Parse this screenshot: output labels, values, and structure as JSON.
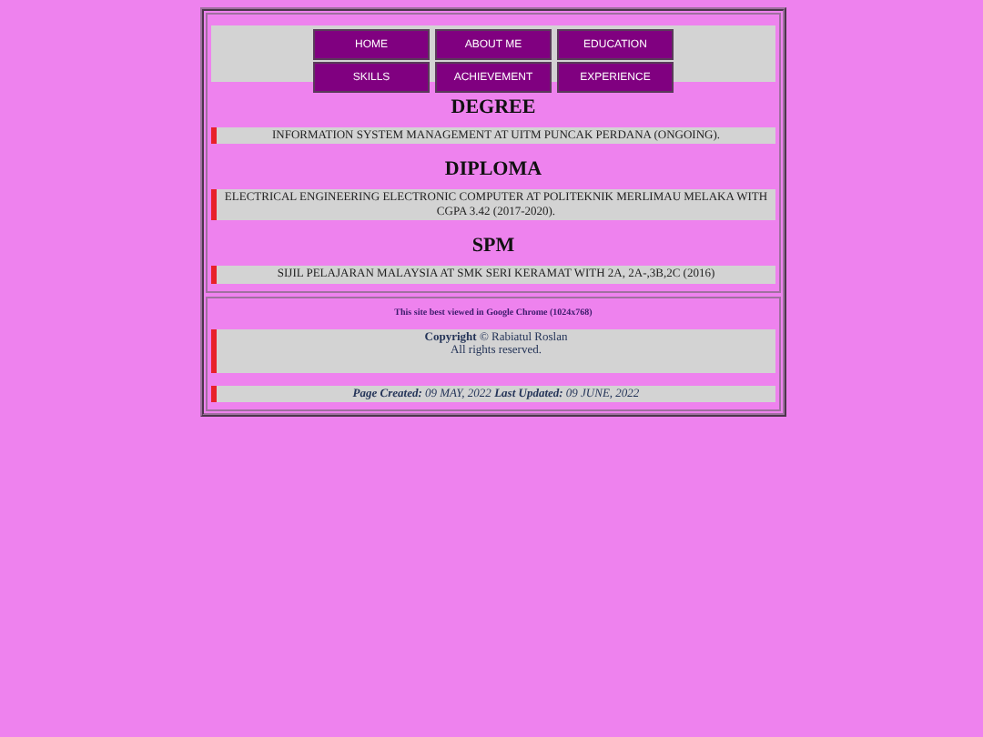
{
  "nav": [
    {
      "label": "HOME"
    },
    {
      "label": "ABOUT ME"
    },
    {
      "label": "EDUCATION"
    },
    {
      "label": "SKILLS"
    },
    {
      "label": "ACHIEVEMENT"
    },
    {
      "label": "EXPERIENCE"
    }
  ],
  "sections": [
    {
      "heading": "DEGREE",
      "text": "INFORMATION SYSTEM MANAGEMENT AT UITM PUNCAK PERDANA (ONGOING)."
    },
    {
      "heading": "DIPLOMA",
      "text": "ELECTRICAL ENGINEERING ELECTRONIC COMPUTER AT POLITEKNIK MERLIMAU MELAKA WITH CGPA 3.42 (2017-2020)."
    },
    {
      "heading": "SPM",
      "text": "SIJIL PELAJARAN MALAYSIA AT SMK SERI KERAMAT WITH 2A, 2A-,3B,2C (2016)"
    }
  ],
  "footer": {
    "note": "This site best viewed in Google Chrome (1024x768)",
    "copyright": "**Copyright** © Rabiatul Roslan",
    "rights": "All rights reserved.",
    "dates": "**Page Created:** 09 MAY, 2022 **Last Updated:** 09 JUNE, 2022"
  }
}
